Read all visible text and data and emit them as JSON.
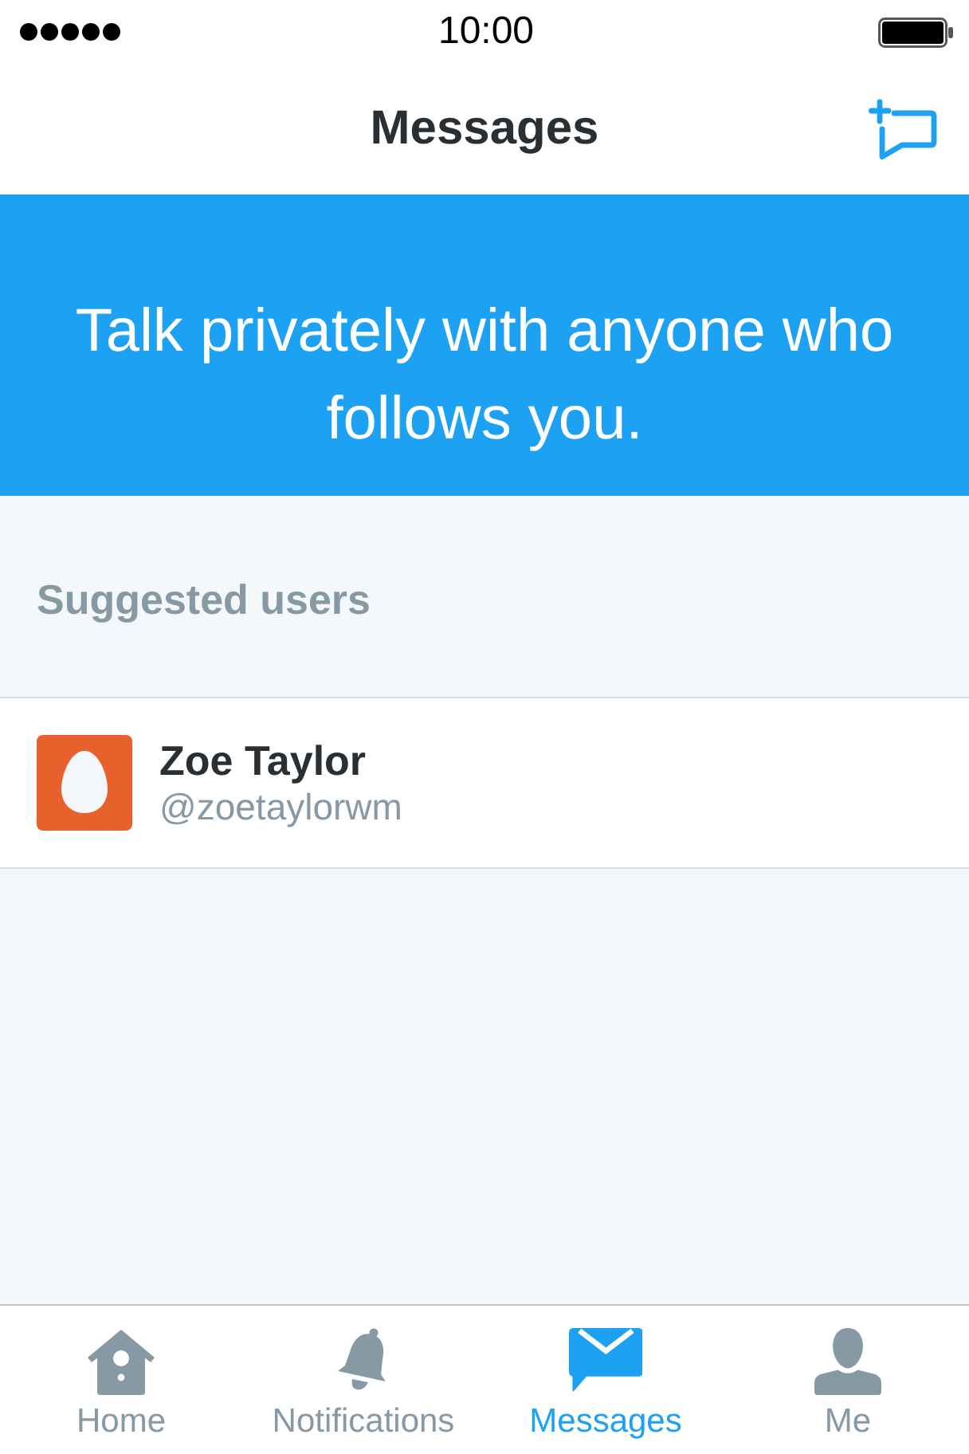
{
  "status_bar": {
    "time": "10:00"
  },
  "nav_bar": {
    "title": "Messages"
  },
  "banner": {
    "text": "Talk privately with anyone who follows you."
  },
  "suggested": {
    "heading": "Suggested users",
    "users": [
      {
        "name": "Zoe Taylor",
        "handle": "@zoetaylorwm"
      }
    ]
  },
  "tab_bar": {
    "tabs": [
      {
        "label": "Home",
        "kind": "home",
        "selected": false
      },
      {
        "label": "Notifications",
        "kind": "notifications",
        "selected": false
      },
      {
        "label": "Messages",
        "kind": "messages",
        "selected": true
      },
      {
        "label": "Me",
        "kind": "me",
        "selected": false
      }
    ]
  }
}
